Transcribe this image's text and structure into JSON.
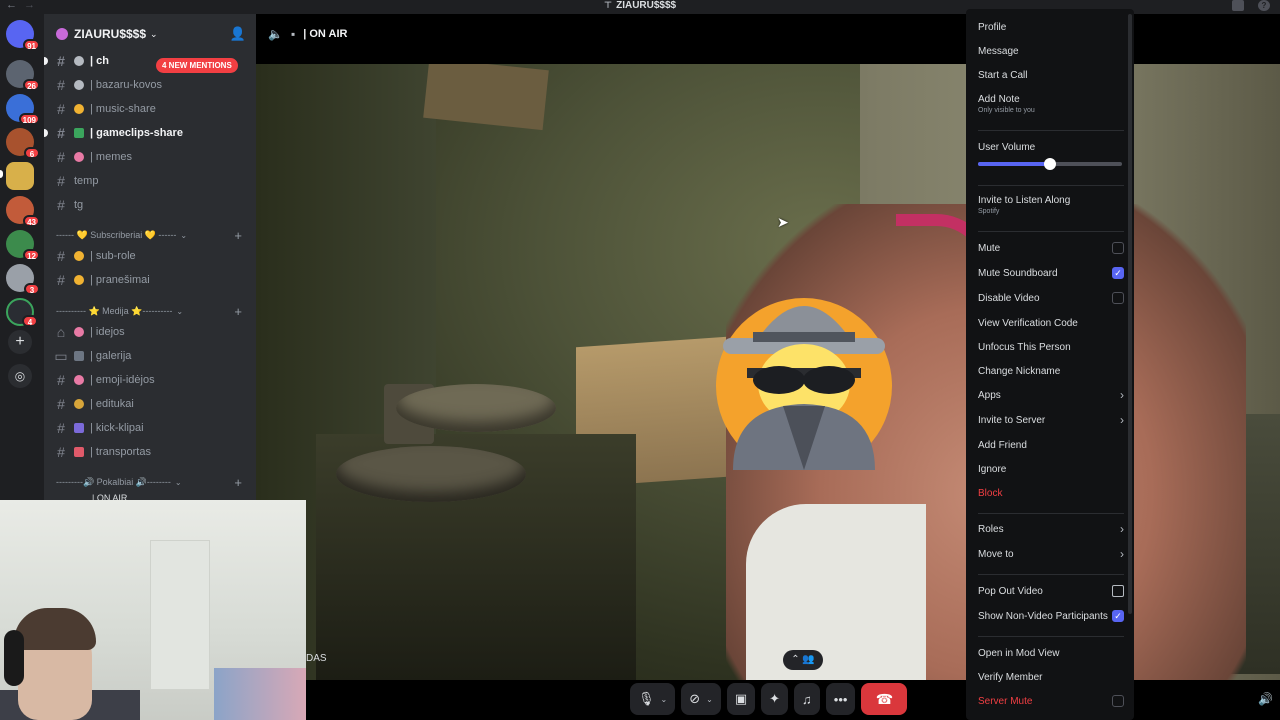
{
  "window": {
    "title": "ZIAURU$$$$",
    "title_icon": "stage-icon"
  },
  "guild": {
    "name": "ZIAURU$$$$",
    "mentions_badge": "4 NEW MENTIONS"
  },
  "rail": {
    "badges": [
      "91",
      "26",
      "109",
      "6",
      "43",
      "12",
      "3",
      "4"
    ]
  },
  "channels": [
    {
      "name": "| ch",
      "bold": true
    },
    {
      "name": "| bazaru-kovos"
    },
    {
      "name": "| music-share"
    },
    {
      "name": "| gameclips-share",
      "bold": true
    },
    {
      "name": "| memes"
    },
    {
      "name": "temp"
    },
    {
      "name": "tg"
    }
  ],
  "categories": {
    "subs": "------ 💛 Subscriberiai 💛 ------",
    "media": "---------- ⭐ Medija ⭐----------",
    "voice": "---------🔊 Pokalbiai 🔊--------"
  },
  "sub_channels": [
    {
      "name": "| sub-role"
    },
    {
      "name": "| pranešimai"
    }
  ],
  "media_channels": [
    {
      "name": "| idejos"
    },
    {
      "name": "| galerija"
    },
    {
      "name": "| emoji-idėjos"
    },
    {
      "name": "| editukai"
    },
    {
      "name": "| kick-klipai"
    },
    {
      "name": "| transportas"
    }
  ],
  "voice_channel": "| ON AIR",
  "stage": {
    "title": "| ON AIR"
  },
  "selfcam_label": "DAS",
  "menu": {
    "profile": "Profile",
    "message": "Message",
    "start_call": "Start a Call",
    "add_note": "Add Note",
    "add_note_sub": "Only visible to you",
    "user_volume": "User Volume",
    "user_volume_level": 0.5,
    "listen_along": "Invite to Listen Along",
    "listen_along_sub": "Spotify",
    "mute": "Mute",
    "mute_soundboard": "Mute Soundboard",
    "disable_video": "Disable Video",
    "view_verification": "View Verification Code",
    "unfocus": "Unfocus This Person",
    "change_nickname": "Change Nickname",
    "apps": "Apps",
    "invite_server": "Invite to Server",
    "add_friend": "Add Friend",
    "ignore": "Ignore",
    "block": "Block",
    "roles": "Roles",
    "move_to": "Move to",
    "pop_out": "Pop Out Video",
    "show_non_video": "Show Non-Video Participants",
    "open_mod_view": "Open in Mod View",
    "verify_member": "Verify Member",
    "server_mute": "Server Mute"
  },
  "colors": {
    "accent": "#5865f2",
    "danger": "#f23f43",
    "menu_bg": "#111214"
  }
}
